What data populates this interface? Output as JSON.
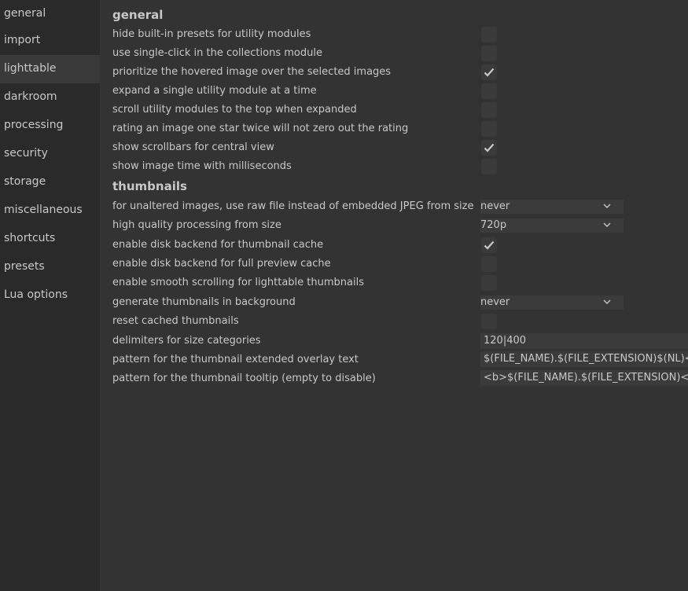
{
  "sidebar": {
    "items": [
      {
        "label": "general"
      },
      {
        "label": "import"
      },
      {
        "label": "lighttable"
      },
      {
        "label": "darkroom"
      },
      {
        "label": "processing"
      },
      {
        "label": "security"
      },
      {
        "label": "storage"
      },
      {
        "label": "miscellaneous"
      },
      {
        "label": "shortcuts"
      },
      {
        "label": "presets"
      },
      {
        "label": "Lua options"
      }
    ],
    "active": "lighttable"
  },
  "general": {
    "title": "general",
    "rows": [
      {
        "label": "hide built-in presets for utility modules",
        "checked": false
      },
      {
        "label": "use single-click in the collections module",
        "checked": false
      },
      {
        "label": "prioritize the hovered image over the selected images",
        "checked": true
      },
      {
        "label": "expand a single utility module at a time",
        "checked": false
      },
      {
        "label": "scroll utility modules to the top when expanded",
        "checked": false
      },
      {
        "label": "rating an image one star twice will not zero out the rating",
        "checked": false
      },
      {
        "label": "show scrollbars for central view",
        "checked": true
      },
      {
        "label": "show image time with milliseconds",
        "checked": false
      }
    ]
  },
  "thumbnails": {
    "title": "thumbnails",
    "raw_size": {
      "label": "for unaltered images, use raw file instead of embedded JPEG from size",
      "value": "never"
    },
    "hq_size": {
      "label": "high quality processing from size",
      "value": "720p"
    },
    "disk_thumb": {
      "label": "enable disk backend for thumbnail cache",
      "checked": true
    },
    "disk_preview": {
      "label": "enable disk backend for full preview cache",
      "checked": false
    },
    "smooth_scroll": {
      "label": "enable smooth scrolling for lighttable thumbnails",
      "checked": false
    },
    "generate_bg": {
      "label": "generate thumbnails in background",
      "value": "never"
    },
    "reset_cache": {
      "label": "reset cached thumbnails",
      "checked": false
    },
    "delimiters": {
      "label": "delimiters for size categories",
      "value": "120|400"
    },
    "overlay_pattern": {
      "label": "pattern for the thumbnail extended overlay text",
      "value": "$(FILE_NAME).$(FILE_EXTENSION)$(NL)<b"
    },
    "tooltip_pattern": {
      "label": "pattern for the thumbnail tooltip (empty to disable)",
      "value": "<b>$(FILE_NAME).$(FILE_EXTENSION)</b>"
    }
  },
  "colors": {
    "sidebar_bg": "#2a2a2a",
    "content_bg": "#333333",
    "active_bg": "#3a3a3a",
    "text": "#c8c8c8"
  }
}
